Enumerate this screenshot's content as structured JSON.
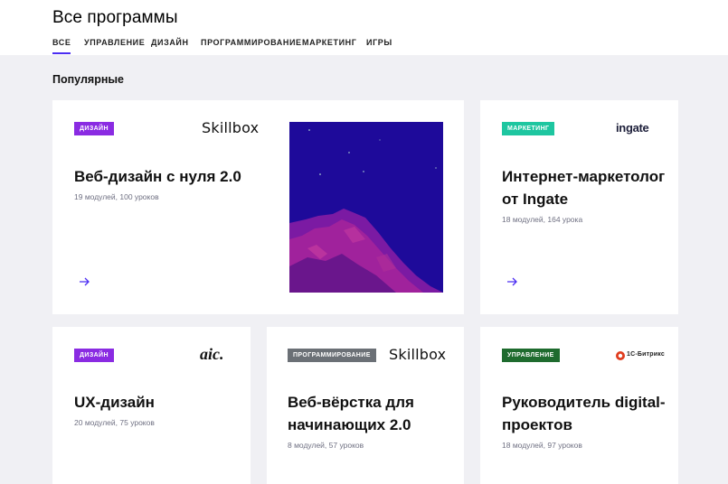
{
  "header": {
    "title": "Все программы",
    "tabs": [
      {
        "label": "ВСЕ"
      },
      {
        "label": "УПРАВЛЕНИЕ"
      },
      {
        "label": "ДИЗАЙН"
      },
      {
        "label": "ПРОГРАММИРОВАНИЕ"
      },
      {
        "label": "МАРКЕТИНГ"
      },
      {
        "label": "ИГРЫ"
      }
    ],
    "active_tab": "ВСЕ",
    "accent_color": "#4b2df2"
  },
  "section": {
    "title": "Популярные"
  },
  "cards": [
    {
      "badge": "ДИЗАЙН",
      "badge_color": "#8a2be2",
      "logo": "Skillbox",
      "title_line1": "Веб-дизайн с нуля 2.0",
      "title_line2": "",
      "meta": "19 модулей, 100 уроков",
      "image": "mountain-night-illustration"
    },
    {
      "badge": "МАРКЕТИНГ",
      "badge_color": "#1ec6a0",
      "logo": "ingate",
      "title_line1": "Интернет-маркетолог",
      "title_line2": "от Ingate",
      "meta": "18 модулей, 164 урока"
    },
    {
      "badge": "ДИЗАЙН",
      "badge_color": "#8a2be2",
      "logo": "aic.",
      "title_line1": "UX-дизайн",
      "title_line2": "",
      "meta": "20 модулей, 75 уроков"
    },
    {
      "badge": "ПРОГРАММИРОВАНИЕ",
      "badge_color": "#6b7076",
      "logo": "Skillbox",
      "title_line1": "Веб-вёрстка для",
      "title_line2": "начинающих 2.0",
      "meta": "8 модулей, 57 уроков"
    },
    {
      "badge": "УПРАВЛЕНИЕ",
      "badge_color": "#1e6b2e",
      "logo": "1С-Битрикс",
      "title_line1": "Руководитель digital-",
      "title_line2": "проектов",
      "meta": "18 модулей, 97 уроков"
    }
  ]
}
